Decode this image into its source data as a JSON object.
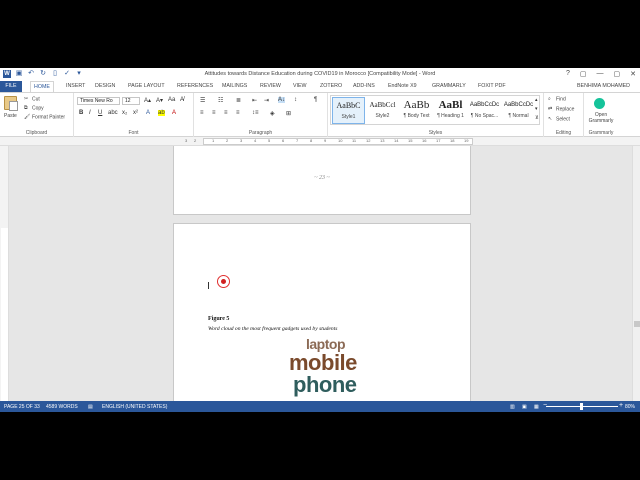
{
  "titlebar": {
    "title": "Attitudes towards Distance Education during COVID19 in Morocco [Compatibility Mode] - Word",
    "help": "?",
    "restore": "▢",
    "minimize": "—",
    "maximize": "▢",
    "close": "✕"
  },
  "tabs": [
    "FILE",
    "HOME",
    "INSERT",
    "DESIGN",
    "PAGE LAYOUT",
    "REFERENCES",
    "MAILINGS",
    "REVIEW",
    "VIEW",
    "ZOTERO",
    "ADD-INS",
    "EndNote X9",
    "GRAMMARLY",
    "FOXIT PDF"
  ],
  "user": "BENHIMA MOHAMED",
  "ribbon": {
    "clipboard": {
      "label": "Clipboard",
      "paste": "Paste",
      "cut": "Cut",
      "copy": "Copy",
      "format_painter": "Format Painter"
    },
    "font": {
      "label": "Font",
      "family": "Times New Ro",
      "size": "12"
    },
    "paragraph": {
      "label": "Paragraph"
    },
    "styles": {
      "label": "Styles",
      "items": [
        {
          "preview": "AaBbC",
          "name": "Style1"
        },
        {
          "preview": "AaBbCcl",
          "name": "Style2"
        },
        {
          "preview": "AaBb",
          "name": "¶ Body Text"
        },
        {
          "preview": "AaBl",
          "name": "¶ Heading 1"
        },
        {
          "preview": "AaBbCcDc",
          "name": "¶ No Spac..."
        },
        {
          "preview": "AaBbCcDc",
          "name": "¶ Normal"
        }
      ]
    },
    "editing": {
      "label": "Editing",
      "find": "Find",
      "replace": "Replace",
      "select": "Select"
    },
    "grammarly": {
      "label": "Grammarly",
      "open": "Open",
      "name": "Grammarly"
    }
  },
  "ruler_numbers": [
    "3",
    "2",
    "1",
    "1",
    "2",
    "3",
    "4",
    "5",
    "6",
    "7",
    "8",
    "9",
    "10",
    "11",
    "12",
    "13",
    "14",
    "15",
    "16",
    "17",
    "18",
    "19"
  ],
  "document": {
    "page_number": "~ 23 ~",
    "figure_label": "Figure 5",
    "figure_caption": "Word cloud on the most frequent gadgets used by students",
    "wordcloud": {
      "laptop": "laptop",
      "mobile": "mobile",
      "phone": "phone"
    }
  },
  "statusbar": {
    "page": "PAGE 25 OF 33",
    "words": "4589 WORDS",
    "language": "ENGLISH (UNITED STATES)",
    "zoom": "80%"
  },
  "colors": {
    "brand": "#2b579a",
    "wordcloud_brown": "#7a4a2c",
    "wordcloud_teal": "#2f5d5d"
  }
}
